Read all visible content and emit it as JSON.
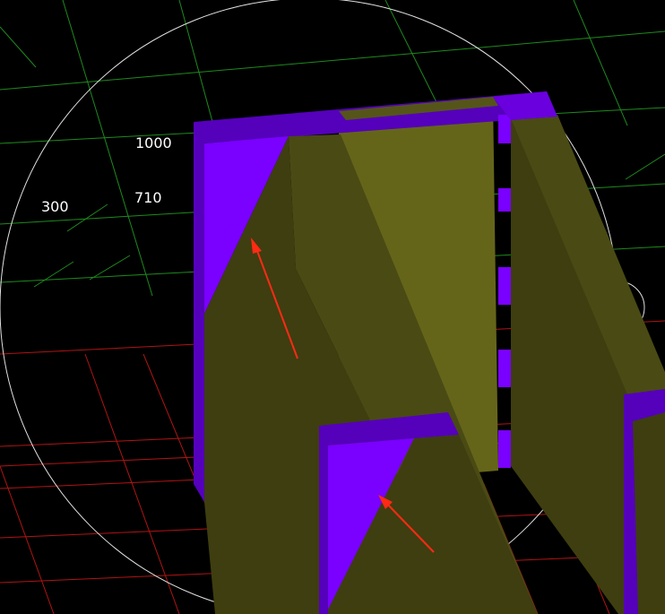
{
  "viewport": {
    "name": "cad-3d-viewport",
    "background": "#000000"
  },
  "dimensions": [
    {
      "id": "dim-1000",
      "text": "1000"
    },
    {
      "id": "dim-710",
      "text": "710"
    },
    {
      "id": "dim-300",
      "text": "300"
    }
  ],
  "colors": {
    "grid_upper": "#1e8a1e",
    "grid_lower": "#b01414",
    "purple_light": "#7a00ff",
    "purple_dark": "#5500bb",
    "olive_front": "#5c5c16",
    "olive_light": "#6b6b1a",
    "olive_dark": "#3e3e10",
    "arrow": "#ff2a14",
    "navigation_ring": "#e0e0e0"
  },
  "icons": {
    "navigation_ring": "orbit-ring-icon",
    "pivot_marker": "orbit-pivot-icon",
    "annotation_arrows": "red-arrow-icon"
  }
}
